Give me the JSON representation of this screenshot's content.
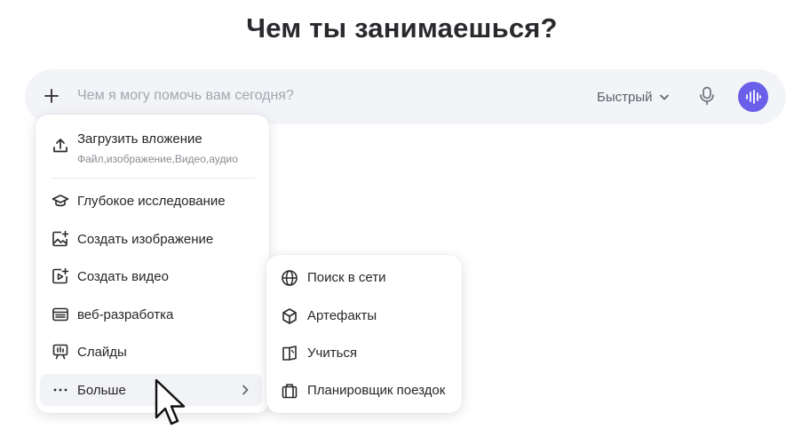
{
  "heading": "Чем ты занимаешься?",
  "prompt": {
    "placeholder": "Чем я могу помочь вам сегодня?",
    "value": "",
    "mode": "Быстрый",
    "accent": "#6a5fe8"
  },
  "attach_menu": {
    "upload": {
      "label": "Загрузить вложение",
      "sub": "Файл,изображение,Видео,аудио",
      "icon": "upload-icon"
    },
    "items": [
      {
        "label": "Глубокое исследование",
        "icon": "graduation-cap-icon"
      },
      {
        "label": "Создать изображение",
        "icon": "image-plus-icon"
      },
      {
        "label": "Создать видео",
        "icon": "video-plus-icon"
      },
      {
        "label": "веб-разработка",
        "icon": "web-window-icon"
      },
      {
        "label": "Слайды",
        "icon": "presentation-icon"
      },
      {
        "label": "Больше",
        "icon": "ellipsis-icon",
        "has_submenu": true,
        "hovered": true
      }
    ]
  },
  "more_menu": {
    "items": [
      {
        "label": "Поиск в сети",
        "icon": "globe-icon"
      },
      {
        "label": "Артефакты",
        "icon": "cube-icon"
      },
      {
        "label": "Учиться",
        "icon": "book-icon"
      },
      {
        "label": "Планировщик поездок",
        "icon": "suitcase-icon"
      }
    ]
  }
}
